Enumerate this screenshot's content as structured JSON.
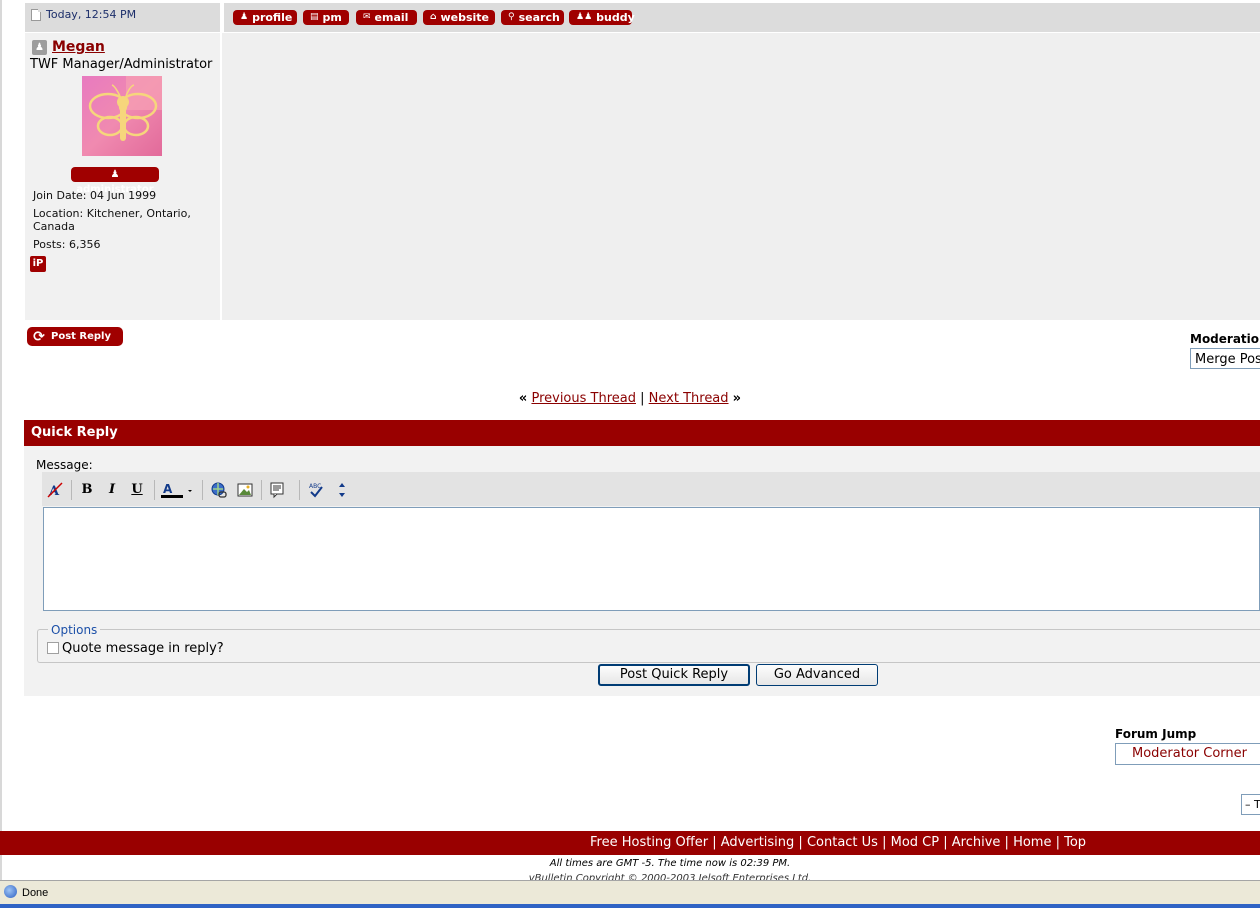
{
  "post": {
    "date": "Today, 12:54 PM",
    "buttons": [
      {
        "label": "profile",
        "icon": "person-icon"
      },
      {
        "label": "pm",
        "icon": "pm-icon"
      },
      {
        "label": "email",
        "icon": "envelope-icon"
      },
      {
        "label": "website",
        "icon": "home-icon"
      },
      {
        "label": "search",
        "icon": "magnifier-icon"
      },
      {
        "label": "buddy",
        "icon": "buddy-icon"
      }
    ],
    "user": {
      "name": "Megan",
      "title": "TWF Manager/Administrator",
      "badge": "administrator",
      "join_date": "Join Date: 04 Jun 1999",
      "location_line1": "Location: Kitchener, Ontario,",
      "location_line2": "Canada",
      "posts": "Posts: 6,356",
      "ip_label": "iP"
    }
  },
  "actions": {
    "post_reply": "Post Reply",
    "moderation_label": "Moderation",
    "moderation_selected": "Merge Posts"
  },
  "thread_nav": {
    "prev_arrows": "«",
    "previous": "Previous Thread",
    "separator": "|",
    "next": "Next Thread",
    "next_arrows": "»"
  },
  "quick_reply": {
    "title": "Quick Reply",
    "message_label": "Message:",
    "options_legend": "Options",
    "quote_label": "Quote message in reply?",
    "post_button": "Post Quick Reply",
    "advanced_button": "Go Advanced",
    "toolbar": [
      "remove-format-icon",
      "bold-icon",
      "italic-icon",
      "underline-icon",
      "font-color-icon",
      "insert-link-icon",
      "insert-image-icon",
      "quote-icon",
      "spellcheck-icon",
      "resize-icon"
    ]
  },
  "forum_jump": {
    "label": "Forum Jump",
    "selected": "Moderator Corner",
    "mini_button": "– T"
  },
  "footer": {
    "links": [
      "Free Hosting Offer",
      "Advertising",
      "Contact Us",
      "Mod CP",
      "Archive",
      "Home",
      "Top"
    ],
    "time": "All times are GMT -5. The time now is 02:39 PM.",
    "copyright": "vBulletin Copyright © 2000-2003 Jelsoft Enterprises Ltd."
  },
  "statusbar": {
    "text": "Done"
  },
  "colors": {
    "accent": "#990000",
    "link": "#8a0000",
    "panel": "#efefef"
  }
}
